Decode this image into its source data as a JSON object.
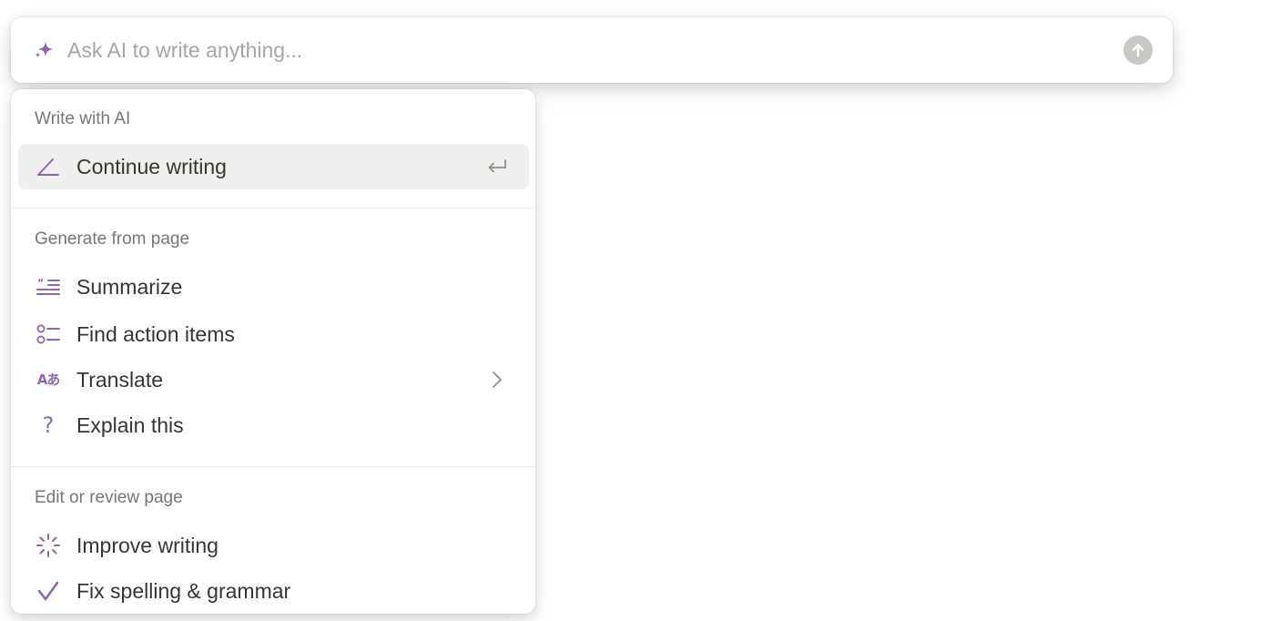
{
  "ai_prompt": {
    "placeholder": "Ask AI to write anything...",
    "value": "",
    "sparkle_icon": "sparkle-icon",
    "submit_icon": "arrow-up-circle-icon"
  },
  "colors": {
    "accent": "#9065b0",
    "text": "#37352f",
    "muted": "#787774",
    "highlight": "#efefed"
  },
  "menu": {
    "sections": [
      {
        "title": "Write with AI",
        "items": [
          {
            "label": "Continue writing",
            "icon": "pen-icon",
            "trailing_icon": "enter-key-icon",
            "highlighted": true
          }
        ]
      },
      {
        "title": "Generate from page",
        "items": [
          {
            "label": "Summarize",
            "icon": "summary-lines-icon"
          },
          {
            "label": "Find action items",
            "icon": "checklist-icon"
          },
          {
            "label": "Translate",
            "icon": "translate-icon",
            "icon_text": "Aあ",
            "trailing_icon": "chevron-right-icon"
          },
          {
            "label": "Explain this",
            "icon": "question-mark-icon",
            "icon_text": "?"
          }
        ]
      },
      {
        "title": "Edit or review page",
        "items": [
          {
            "label": "Improve writing",
            "icon": "magic-burst-icon"
          },
          {
            "label": "Fix spelling & grammar",
            "icon": "checkmark-icon"
          }
        ]
      }
    ]
  }
}
